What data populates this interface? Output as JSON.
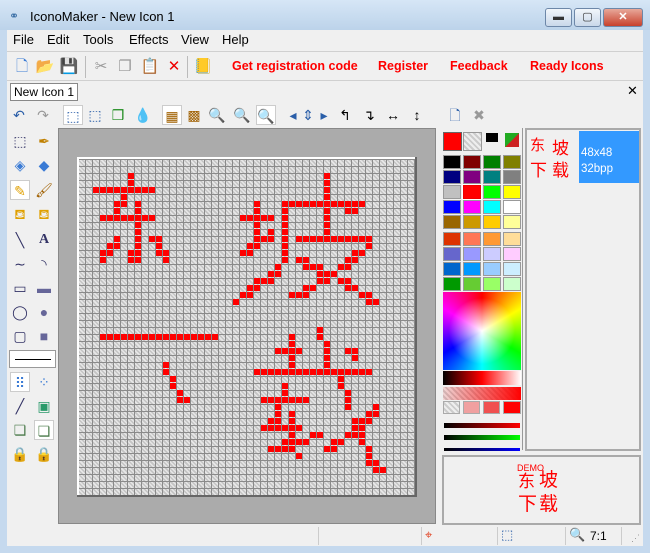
{
  "window": {
    "title": "IconoMaker - New Icon 1",
    "minimize": "▬",
    "maximize": "▢",
    "close": "✕"
  },
  "menu": [
    "File",
    "Edit",
    "Tools",
    "Effects",
    "View",
    "Help"
  ],
  "toolbar": {
    "links": [
      "Get registration code",
      "Register",
      "Feedback",
      "Ready Icons"
    ]
  },
  "tabs": [
    {
      "label": "New Icon 1"
    }
  ],
  "tab_close": "✕",
  "preview": {
    "size": "48x48",
    "depth": "32bpp",
    "demo": "DEMO",
    "glyphs": [
      "东",
      "坡",
      "下",
      "载"
    ]
  },
  "status": {
    "zoom": "7:1"
  },
  "colors": {
    "primary": "#ff0000",
    "selection": "#3399ff"
  },
  "palette": [
    [
      "#000000",
      "#800000",
      "#008000",
      "#808000"
    ],
    [
      "#000080",
      "#800080",
      "#008080",
      "#808080"
    ],
    [
      "#c0c0c0",
      "#ff0000",
      "#00ff00",
      "#ffff00"
    ],
    [
      "#0000ff",
      "#ff00ff",
      "#00ffff",
      "#ffffff"
    ],
    [
      "#996600",
      "#cc9900",
      "#ffcc00",
      "#ffff99"
    ],
    [
      "#dd3300",
      "#ff7755",
      "#ff9933",
      "#ffdd99"
    ],
    [
      "#6666cc",
      "#9999ff",
      "#ccccff",
      "#ffccff"
    ],
    [
      "#0066cc",
      "#0099ff",
      "#99ccff",
      "#cceeff"
    ],
    [
      "#009900",
      "#66cc33",
      "#99ff66",
      "#ccffcc"
    ]
  ],
  "icon_image": {
    "width": 48,
    "height": 48,
    "zoom": "7:1"
  }
}
